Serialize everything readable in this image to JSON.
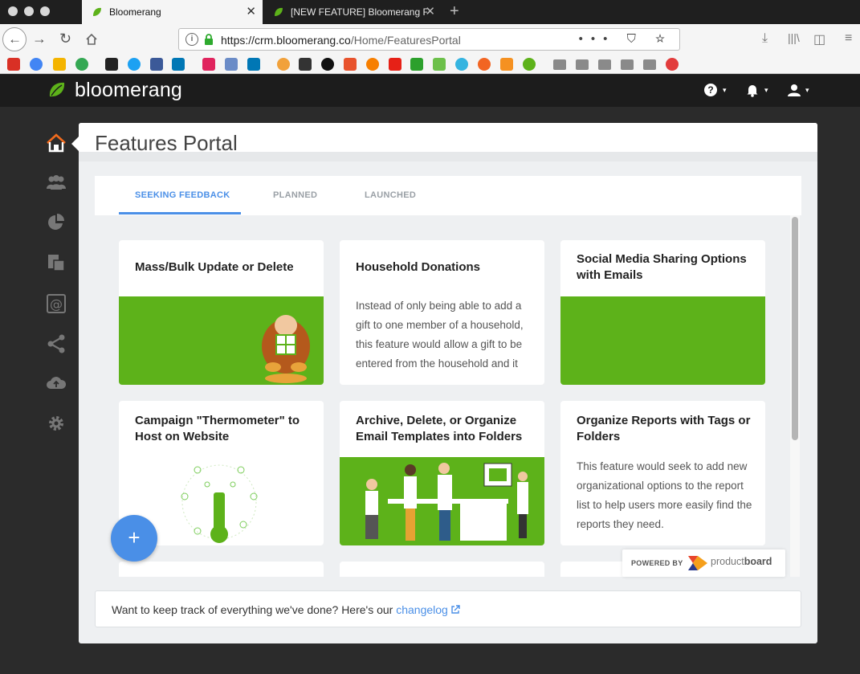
{
  "browser": {
    "tabs": [
      {
        "title": "Bloomerang"
      },
      {
        "title": "[NEW FEATURE] Bloomerang Fe"
      }
    ],
    "url_host": "https://crm.bloomerang.co",
    "url_path": "/Home/FeaturesPortal",
    "url_tools": "••• ⛉ ☆"
  },
  "app": {
    "brand": "bloomerang",
    "help_icon": "?",
    "caret": "▾"
  },
  "page": {
    "title": "Features Portal",
    "tabs": [
      {
        "label": "SEEKING FEEDBACK",
        "active": true
      },
      {
        "label": "PLANNED",
        "active": false
      },
      {
        "label": "LAUNCHED",
        "active": false
      }
    ]
  },
  "cards": [
    {
      "title": "Mass/Bulk Update or Delete",
      "desc": ""
    },
    {
      "title": "Household Donations",
      "desc": "Instead of only being able to add a gift to one member of a household, this feature would allow a gift to be entered from the household and it"
    },
    {
      "title": "Social Media Sharing Options with Emails",
      "desc": ""
    },
    {
      "title": "Campaign \"Thermometer\" to Host on Website",
      "desc": ""
    },
    {
      "title": "Archive, Delete, or Organize Email Templates into Folders",
      "desc": ""
    },
    {
      "title": "Organize Reports with Tags or Folders",
      "desc": "This feature would seek to add new organizational options to the report list to help users more easily find the reports they need."
    }
  ],
  "fab_label": "+",
  "powered": {
    "label": "POWERED BY",
    "product": "product",
    "product_bold": "board"
  },
  "footer": {
    "text": "Want to keep track of everything we've done? Here's our ",
    "link": "changelog"
  },
  "colors": {
    "brand_green": "#5db21a",
    "accent_blue": "#4a8fe7"
  }
}
